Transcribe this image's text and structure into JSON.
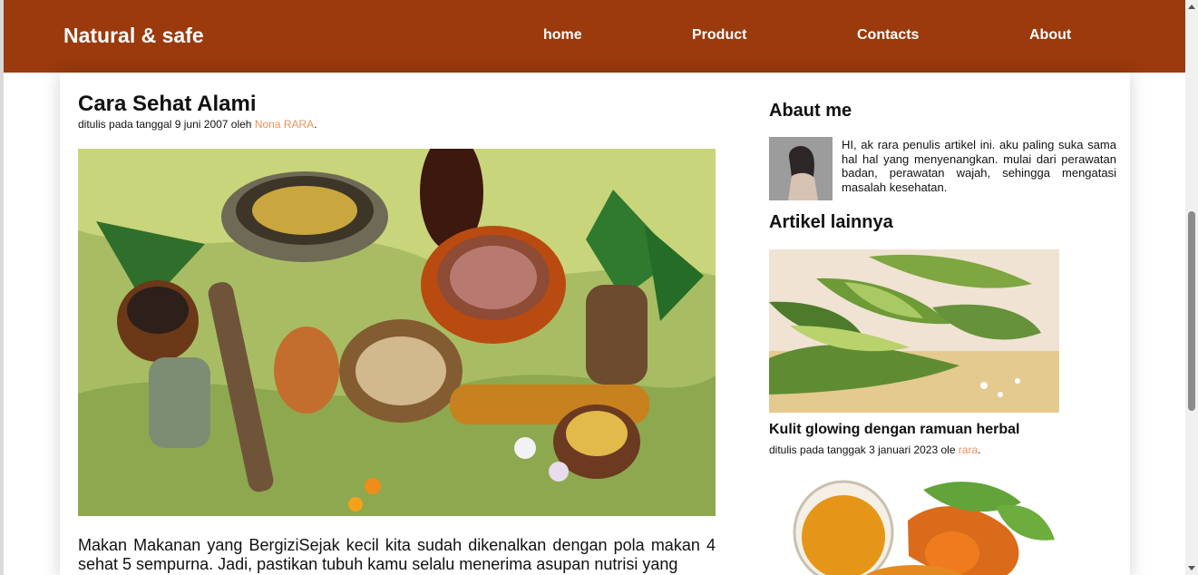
{
  "nav": {
    "brand": "Natural & safe",
    "links": [
      "home",
      "Product",
      "Contacts",
      "About"
    ]
  },
  "article": {
    "title": "Cara Sehat Alami",
    "meta_prefix": "ditulis pada tanggal 9 juni 2007 oleh ",
    "author": "Nona RARA",
    "meta_suffix": ".",
    "body": "Makan Makanan yang BergiziSejak kecil kita sudah dikenalkan dengan pola makan 4 sehat 5 sempurna. Jadi, pastikan tubuh kamu selalu menerima asupan nutrisi yang"
  },
  "sidebar": {
    "about_heading": "Abaut me",
    "about_text": "HI, ak rara penulis artikel ini. aku paling suka sama hal hal yang menyenangkan. mulai dari perawatan badan, perawatan wajah, sehingga mengatasi masalah kesehatan.",
    "other_heading": "Artikel lainnya",
    "post1": {
      "title": "Kulit glowing dengan ramuan herbal",
      "meta_prefix": "ditulis pada tanggak 3 januari 2023 ole ",
      "author": "rara",
      "meta_suffix": "."
    }
  },
  "icons": {
    "scroll_up": "chevron-up-icon",
    "scroll_down": "chevron-down-icon"
  },
  "colors": {
    "navbar": "#9b3a0c",
    "author_link": "#e8935a"
  }
}
